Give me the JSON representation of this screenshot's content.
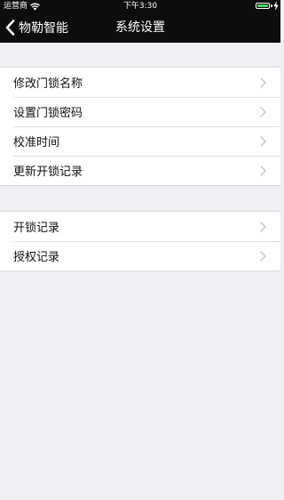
{
  "status_bar": {
    "carrier": "运营商",
    "time": "下午3:30",
    "icons": [
      "wifi-icon",
      "battery-icon",
      "charging-icon"
    ],
    "battery_color": "#4cd964"
  },
  "nav": {
    "back_label": "物勒智能",
    "title": "系统设置",
    "background": "#0d0d0d"
  },
  "groups": [
    {
      "items": [
        {
          "label": "修改门锁名称"
        },
        {
          "label": "设置门锁密码"
        },
        {
          "label": "校准时间"
        },
        {
          "label": "更新开锁记录"
        }
      ]
    },
    {
      "items": [
        {
          "label": "开锁记录"
        },
        {
          "label": "授权记录"
        }
      ]
    }
  ],
  "colors": {
    "page_background": "#efeff4",
    "cell_background": "#ffffff",
    "chevron": "#c4c4c9"
  }
}
